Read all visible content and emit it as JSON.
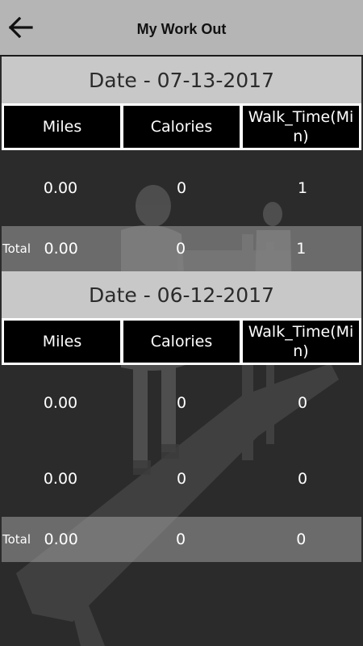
{
  "header": {
    "title": "My Work Out",
    "back_icon": "arrow-left-icon"
  },
  "columns": [
    "Miles",
    "Calories",
    "Walk_Time(Min)"
  ],
  "total_label": "Total",
  "workouts": [
    {
      "date": "Date - 07-13-2017",
      "rows": [
        {
          "miles": "0.00",
          "calories": "0",
          "walk_time": "1"
        }
      ],
      "total": {
        "miles": "0.00",
        "calories": "0",
        "walk_time": "1"
      }
    },
    {
      "date": "Date - 06-12-2017",
      "rows": [
        {
          "miles": "0.00",
          "calories": "0",
          "walk_time": "0"
        },
        {
          "miles": "0.00",
          "calories": "0",
          "walk_time": "0"
        }
      ],
      "total": {
        "miles": "0.00",
        "calories": "0",
        "walk_time": "0"
      }
    }
  ],
  "colors": {
    "header_bg": "#b5b5b5",
    "date_bar_bg": "#c8c8c8",
    "column_header_bg": "#000000",
    "page_bg": "#2b2b2b",
    "total_row_bg": "#8f8f8f"
  }
}
